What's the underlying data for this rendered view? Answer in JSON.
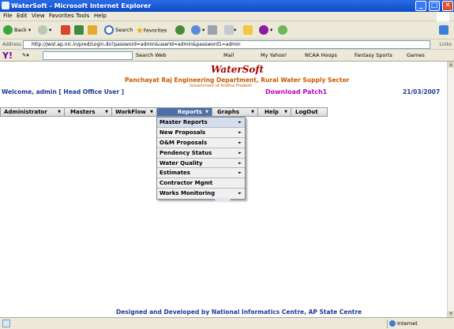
{
  "window": {
    "title": "WaterSoft - Microsoft Internet Explorer",
    "controls": {
      "minimize": "_",
      "maximize": "□",
      "close": "✕"
    }
  },
  "menubar": [
    "File",
    "Edit",
    "View",
    "Favorites",
    "Tools",
    "Help"
  ],
  "toolbar": {
    "back": "Back",
    "search": "Search",
    "favorites": "Favorites"
  },
  "address": {
    "label": "Address",
    "url": "http://jwst.ap.nic.in/pred/Login.do?password=admin&userId=admin&password1=admin",
    "links": "Links"
  },
  "yahoo": {
    "logo": "Y!",
    "search_web": "Search Web",
    "mail": "Mail",
    "my_yahoo": "My Yahoo!",
    "ncaa": "NCAA Hoops",
    "fantasy": "Fantasy Sports",
    "games": "Games"
  },
  "header": {
    "brand": "WaterSoft",
    "department": "Panchayat Raj Engineering Department, Rural Water Supply Sector",
    "government": "Government of Andhra Pradesh",
    "welcome": "Welcome, admin [ Head Office User ]",
    "download": "Download Patch1",
    "date": "21/03/2007"
  },
  "nav": {
    "items": [
      {
        "label": "Administrator",
        "arrow": "▼"
      },
      {
        "label": "Masters",
        "arrow": "▼"
      },
      {
        "label": "WorkFlow",
        "arrow": "▼"
      },
      {
        "label": "Reports",
        "arrow": "▼"
      },
      {
        "label": "Graphs",
        "arrow": "▼"
      },
      {
        "label": "Help",
        "arrow": "▼"
      },
      {
        "label": "LogOut",
        "arrow": ""
      }
    ],
    "active": "Reports"
  },
  "reports_menu": [
    {
      "label": "Master Reports",
      "sub": "►"
    },
    {
      "label": "New Proposals",
      "sub": "►"
    },
    {
      "label": "O&M Proposals",
      "sub": "►"
    },
    {
      "label": "Pendency Status",
      "sub": "►"
    },
    {
      "label": "Water Quality",
      "sub": "►"
    },
    {
      "label": "Estimates",
      "sub": "►"
    },
    {
      "label": "Contractor Mgmt",
      "sub": ""
    },
    {
      "label": "Works Monitoring",
      "sub": "►"
    }
  ],
  "footer": "Designed and Developed by National Informatics Centre, AP State Centre",
  "status": {
    "zone": "Internet"
  },
  "colors": {
    "brand": "#a80000",
    "accent": "#1d3a9a",
    "dept": "#c85a00",
    "download": "#c000c0",
    "active_tab": "#4e6fa8"
  }
}
